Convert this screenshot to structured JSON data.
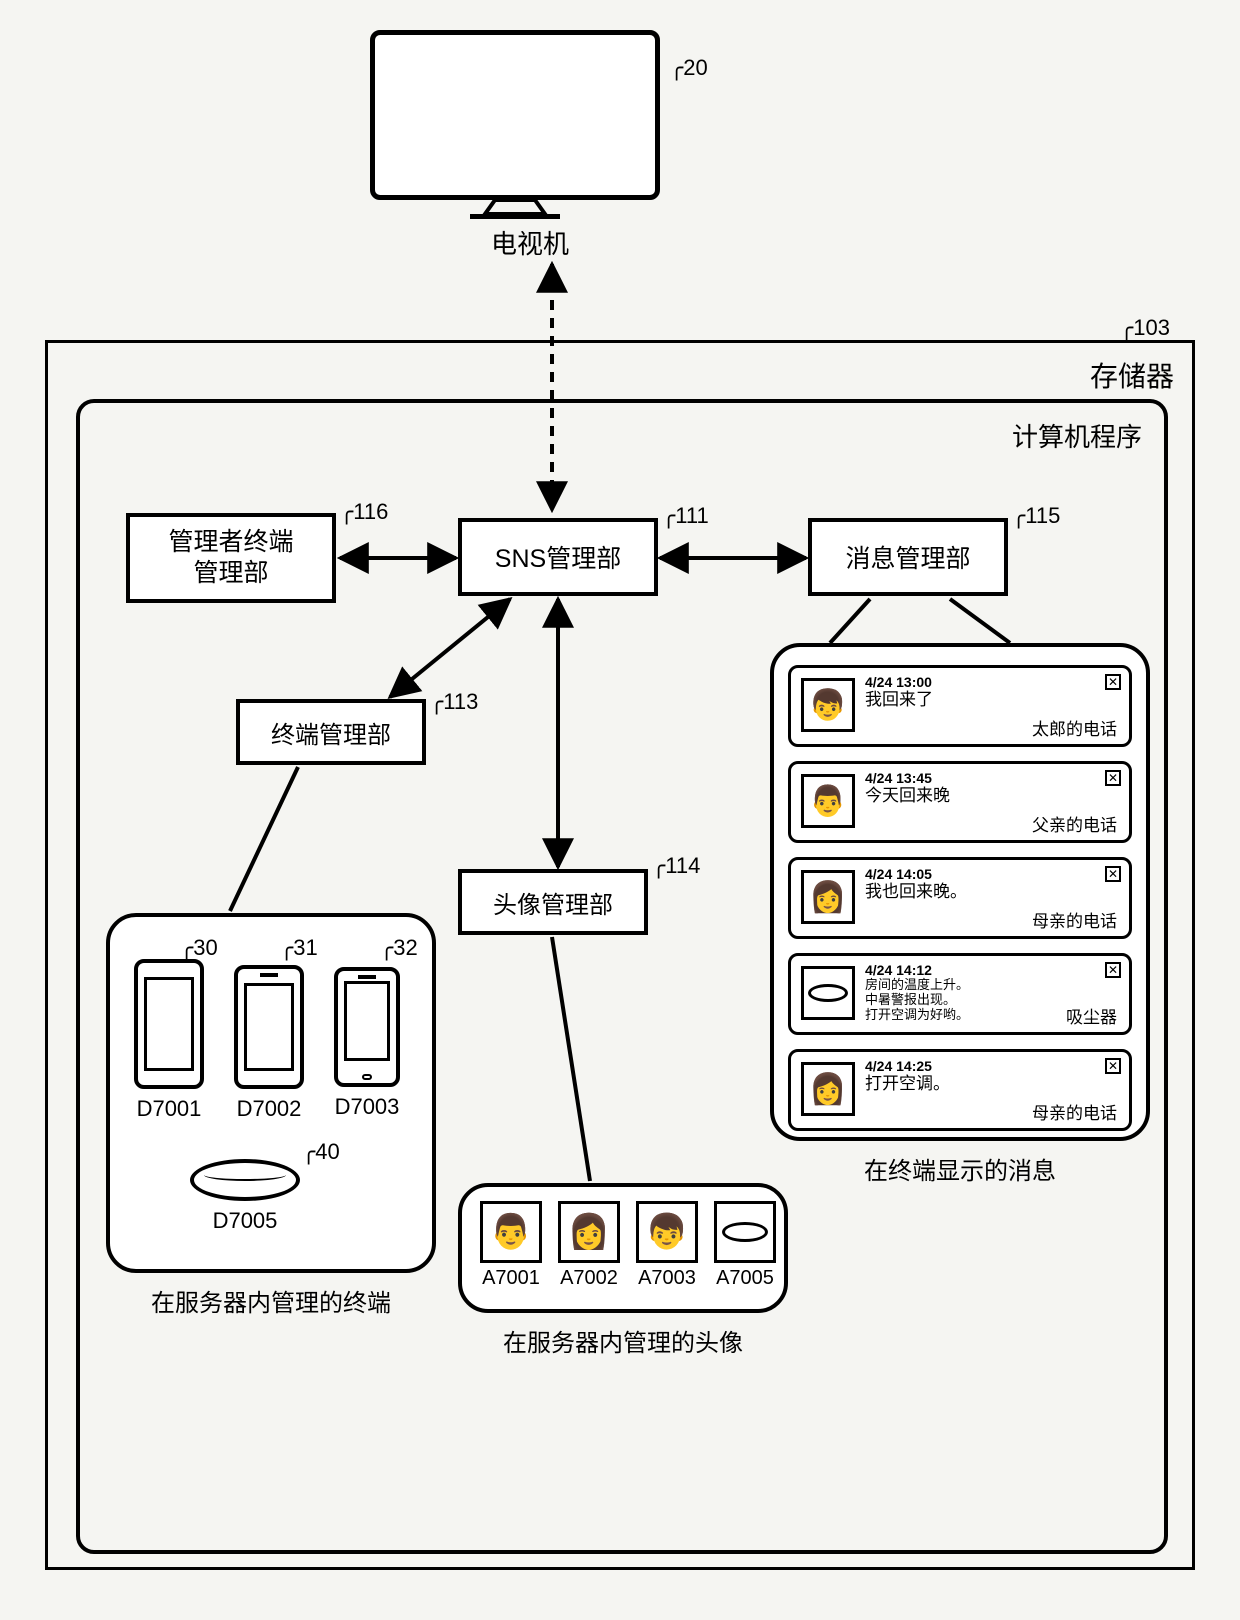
{
  "tv": {
    "label": "电视机",
    "ref": "20"
  },
  "memory": {
    "label": "存储器",
    "ref": "103"
  },
  "program": {
    "label": "计算机程序"
  },
  "modules": {
    "admin_terminal": {
      "label": "管理者终端\n管理部",
      "ref": "116"
    },
    "sns": {
      "label": "SNS管理部",
      "ref": "111"
    },
    "message": {
      "label": "消息管理部",
      "ref": "115"
    },
    "terminal": {
      "label": "终端管理部",
      "ref": "113"
    },
    "avatar": {
      "label": "头像管理部",
      "ref": "114"
    }
  },
  "terminals_bubble": {
    "caption": "在服务器内管理的终端",
    "devices": [
      {
        "id": "D7001",
        "ref": "30",
        "kind": "phone-tall"
      },
      {
        "id": "D7002",
        "ref": "31",
        "kind": "phone"
      },
      {
        "id": "D7003",
        "ref": "32",
        "kind": "phone-sm"
      },
      {
        "id": "D7005",
        "ref": "40",
        "kind": "robot"
      }
    ]
  },
  "avatars_bubble": {
    "caption": "在服务器内管理的头像",
    "items": [
      {
        "id": "A7001",
        "icon": "face-glasses"
      },
      {
        "id": "A7002",
        "icon": "face-woman"
      },
      {
        "id": "A7003",
        "icon": "face-boy"
      },
      {
        "id": "A7005",
        "icon": "robot"
      }
    ]
  },
  "messages_bubble": {
    "caption": "在终端显示的消息",
    "cards": [
      {
        "ts": "4/24 13:00",
        "body": "我回来了",
        "sender": "太郎的电话",
        "icon": "face-boy"
      },
      {
        "ts": "4/24 13:45",
        "body": "今天回来晚",
        "sender": "父亲的电话",
        "icon": "face-glasses"
      },
      {
        "ts": "4/24 14:05",
        "body": "我也回来晚。",
        "sender": "母亲的电话",
        "icon": "face-woman"
      },
      {
        "ts": "4/24 14:12",
        "body": "房间的温度上升。\n中暑警报出现。\n打开空调为好哟。",
        "sender": "吸尘器",
        "icon": "robot"
      },
      {
        "ts": "4/24 14:25",
        "body": "打开空调。",
        "sender": "母亲的电话",
        "icon": "face-woman"
      }
    ]
  }
}
